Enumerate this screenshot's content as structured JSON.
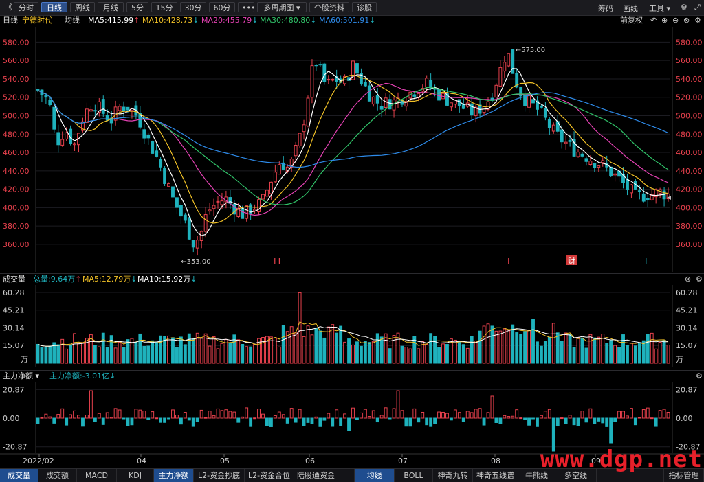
{
  "toolbar": {
    "back": "《",
    "tabs": [
      "分时",
      "日线",
      "周线",
      "月线",
      "5分",
      "15分",
      "30分",
      "60分",
      "•••",
      "多周期图",
      "个股资料",
      "诊股"
    ],
    "active_tab": "日线",
    "right": {
      "chips": "筹码",
      "draw": "画线",
      "tools": "工具"
    }
  },
  "header": {
    "period": "日线",
    "stock": "宁德时代",
    "ma_label": "均线",
    "ma5": "MA5:415.99",
    "ma10": "MA10:428.73",
    "ma20": "MA20:455.79",
    "ma30": "MA30:480.80",
    "ma60": "MA60:501.91",
    "adjust": "前复权"
  },
  "price_chart": {
    "y_ticks": [
      "580.00",
      "560.00",
      "540.00",
      "520.00",
      "500.00",
      "480.00",
      "460.00",
      "440.00",
      "420.00",
      "400.00",
      "380.00",
      "360.00"
    ],
    "y_values": [
      580,
      560,
      540,
      520,
      500,
      480,
      460,
      440,
      420,
      400,
      380,
      360
    ],
    "high_label": "575.00",
    "low_label": "353.00",
    "markers": [
      "LL",
      "L",
      "财",
      "L"
    ]
  },
  "volume_panel": {
    "title": "成交量",
    "total": "总量:9.64万",
    "ma5": "MA5:12.79万",
    "ma10": "MA10:15.92万",
    "y_ticks": [
      "60.28",
      "45.21",
      "30.14",
      "15.07",
      "万"
    ],
    "values": [
      60.28,
      45.21,
      30.14,
      15.07
    ]
  },
  "flow_panel": {
    "title": "主力净额",
    "value": "主力净额:-3.01亿",
    "y_ticks": [
      "20.87",
      "0.00",
      "-20.87"
    ],
    "values": [
      20.87,
      0,
      -20.87
    ]
  },
  "x_axis": {
    "labels": [
      "2022/02",
      "04",
      "05",
      "06",
      "07",
      "08",
      "09"
    ]
  },
  "bottom_tabs": [
    "成交量",
    "成交额",
    "MACD",
    "KDJ",
    "主力净额",
    "L2-资金抄底",
    "L2-资金合位",
    "陆股通资金",
    "",
    "均线",
    "BOLL",
    "神奇九转",
    "神奇五线谱",
    "牛熊线",
    "多空线",
    "",
    "指标管理"
  ],
  "colors": {
    "up": "#e8414d",
    "down": "#1fb2bd",
    "ma5": "#ffffff",
    "ma10": "#f2c227",
    "ma20": "#e542b4",
    "ma30": "#31c46a",
    "ma60": "#2e8bea"
  },
  "watermark": "www.dgp.net"
}
